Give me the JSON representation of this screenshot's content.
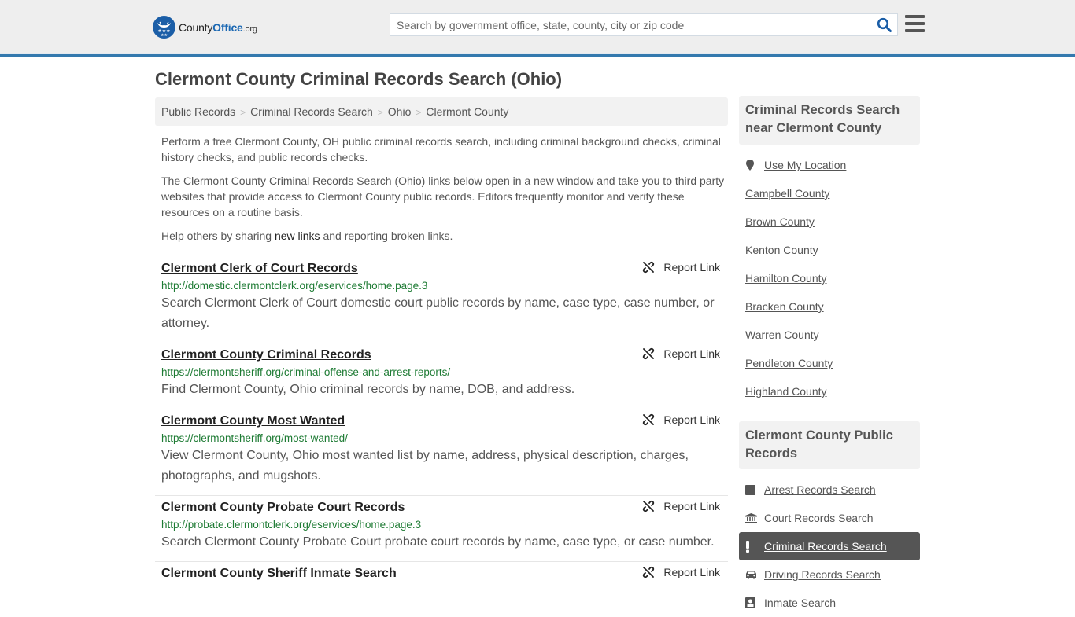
{
  "header": {
    "logo": {
      "name": "County",
      "name_accent": "Office",
      "tld": ".org"
    },
    "search": {
      "placeholder": "Search by government office, state, county, city or zip code",
      "value": ""
    },
    "colors": {
      "brand": "#1b5ea7",
      "accent_border": "#3479ae"
    }
  },
  "page": {
    "title": "Clermont County Criminal Records Search (Ohio)",
    "breadcrumb": [
      "Public Records",
      "Criminal Records Search",
      "Ohio",
      "Clermont County"
    ],
    "intro": {
      "p1": "Perform a free Clermont County, OH public criminal records search, including criminal background checks, criminal history checks, and public records checks.",
      "p2": "The Clermont County Criminal Records Search (Ohio) links below open in a new window and take you to third party websites that provide access to Clermont County public records. Editors frequently monitor and verify these resources on a routine basis.",
      "p3_before": "Help others by sharing ",
      "p3_link": "new links",
      "p3_after": " and reporting broken links."
    },
    "report_label": "Report Link",
    "results": [
      {
        "title": "Clermont Clerk of Court Records",
        "url": "http://domestic.clermontclerk.org/eservices/home.page.3",
        "desc": "Search Clermont Clerk of Court domestic court public records by name, case type, case number, or attorney."
      },
      {
        "title": "Clermont County Criminal Records",
        "url": "https://clermontsheriff.org/criminal-offense-and-arrest-reports/",
        "desc": "Find Clermont County, Ohio criminal records by name, DOB, and address."
      },
      {
        "title": "Clermont County Most Wanted",
        "url": "https://clermontsheriff.org/most-wanted/",
        "desc": "View Clermont County, Ohio most wanted list by name, address, physical description, charges, photographs, and mugshots."
      },
      {
        "title": "Clermont County Probate Court Records",
        "url": "http://probate.clermontclerk.org/eservices/home.page.3",
        "desc": "Search Clermont County Probate Court probate court records by name, case type, or case number."
      },
      {
        "title": "Clermont County Sheriff Inmate Search",
        "url": "",
        "desc": ""
      }
    ]
  },
  "sidebar": {
    "nearby": {
      "heading": "Criminal Records Search near Clermont County",
      "use_location": "Use My Location",
      "counties": [
        "Campbell County",
        "Brown County",
        "Kenton County",
        "Hamilton County",
        "Bracken County",
        "Warren County",
        "Pendleton County",
        "Highland County"
      ]
    },
    "public_records": {
      "heading": "Clermont County Public Records",
      "items": [
        {
          "label": "Arrest Records Search",
          "icon": "square-icon"
        },
        {
          "label": "Court Records Search",
          "icon": "courthouse-icon"
        },
        {
          "label": "Criminal Records Search",
          "icon": "exclamation-icon",
          "active": true
        },
        {
          "label": "Driving Records Search",
          "icon": "car-icon"
        },
        {
          "label": "Inmate Search",
          "icon": "inmate-icon"
        }
      ]
    }
  }
}
